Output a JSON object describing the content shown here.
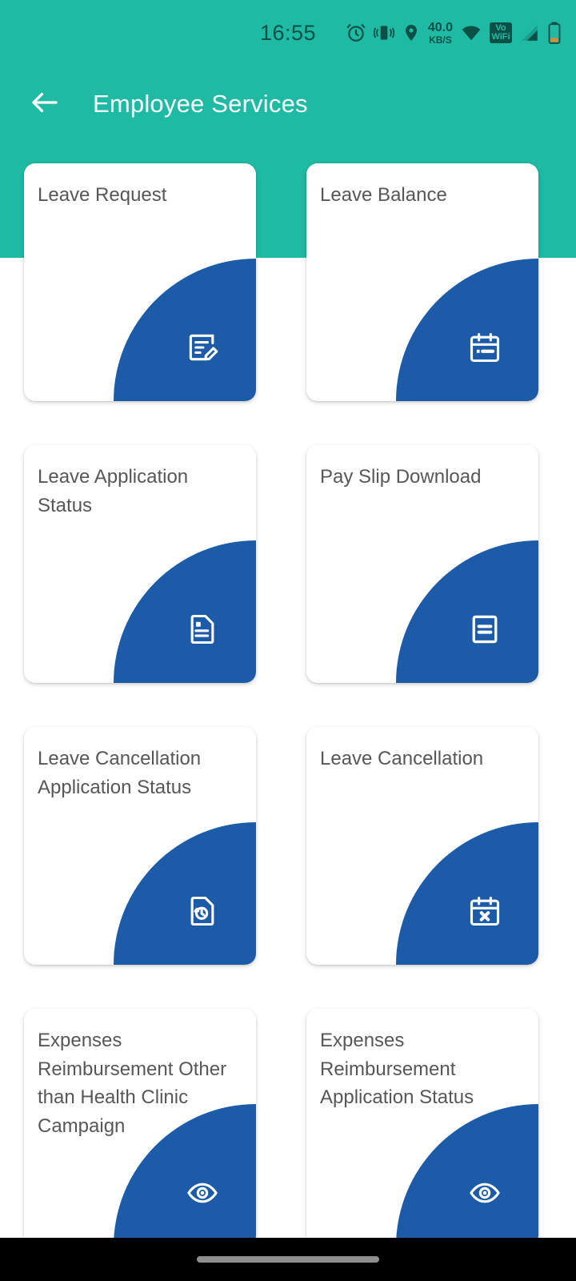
{
  "status_bar": {
    "time": "16:55",
    "network_speed_value": "40.0",
    "network_speed_unit": "KB/S",
    "vowifi_top": "Vo",
    "vowifi_bottom": "WiFi",
    "icons": [
      "alarm-icon",
      "vibrate-icon",
      "location-icon",
      "network-speed-indicator",
      "wifi-icon",
      "vowifi-icon",
      "cellular-signal-icon",
      "battery-icon"
    ]
  },
  "app_bar": {
    "back_icon": "back-arrow-icon",
    "title": "Employee Services"
  },
  "colors": {
    "header_teal": "#1ebaa4",
    "corner_blue": "#1c5ba8",
    "card_white": "#ffffff",
    "title_text": "#575757",
    "nav_bar_black": "#000000"
  },
  "cards": [
    {
      "title": "Leave Request",
      "icon": "edit-document-icon"
    },
    {
      "title": "Leave Balance",
      "icon": "calendar-event-icon"
    },
    {
      "title": "Leave Application Status",
      "icon": "document-lines-icon"
    },
    {
      "title": "Pay Slip Download",
      "icon": "receipt-icon"
    },
    {
      "title": "Leave Cancellation Application Status",
      "icon": "document-history-icon"
    },
    {
      "title": "Leave Cancellation",
      "icon": "calendar-cancel-icon"
    },
    {
      "title": "Expenses Reimbursement Other than Health Clinic Campaign",
      "icon": "eye-icon"
    },
    {
      "title": "Expenses Reimbursement Application Status",
      "icon": "eye-icon"
    }
  ],
  "nav_bar": {
    "gesture_pill": "home-gesture-pill"
  }
}
